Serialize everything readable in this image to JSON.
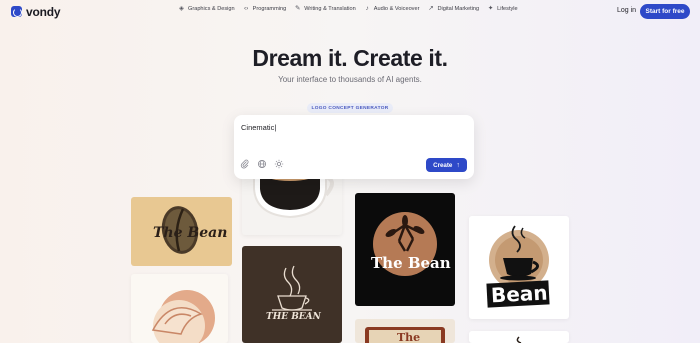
{
  "brand": {
    "name": "vondy"
  },
  "nav": {
    "items": [
      {
        "label": "Graphics & Design",
        "icon": "palette-icon",
        "glyph": "◈"
      },
      {
        "label": "Programming",
        "icon": "code-icon",
        "glyph": "‹›"
      },
      {
        "label": "Writing & Translation",
        "icon": "pen-icon",
        "glyph": "✎"
      },
      {
        "label": "Audio & Voiceover",
        "icon": "microphone-icon",
        "glyph": "♪"
      },
      {
        "label": "Digital Marketing",
        "icon": "trend-icon",
        "glyph": "↗"
      },
      {
        "label": "Lifestyle",
        "icon": "sparkle-icon",
        "glyph": "✦"
      }
    ],
    "login": "Log in",
    "cta": "Start for free"
  },
  "hero": {
    "title": "Dream it. Create it.",
    "subtitle": "Your interface to thousands of AI agents."
  },
  "generator": {
    "badge": "LOGO CONCEPT GENERATOR",
    "input_value": "Cinematic|",
    "create_label": "Create",
    "tools": [
      "paperclip-icon",
      "globe-icon",
      "sun-icon"
    ]
  },
  "gallery": {
    "tiles": [
      {
        "id": "bean-coffee-bean",
        "text": "The Bean"
      },
      {
        "id": "croissant-cup",
        "text": ""
      },
      {
        "id": "latte-cup",
        "text": ""
      },
      {
        "id": "steam-cup-dark",
        "text": "THE BEAN"
      },
      {
        "id": "circle-leaves",
        "text": "The Bean"
      },
      {
        "id": "retro-sign",
        "text": "The"
      },
      {
        "id": "mug-bean",
        "text": "Bean"
      },
      {
        "id": "partial-bottom",
        "text": ""
      }
    ]
  },
  "colors": {
    "accent": "#2e49c8",
    "text": "#1e1e26",
    "muted": "#6b6b74"
  }
}
